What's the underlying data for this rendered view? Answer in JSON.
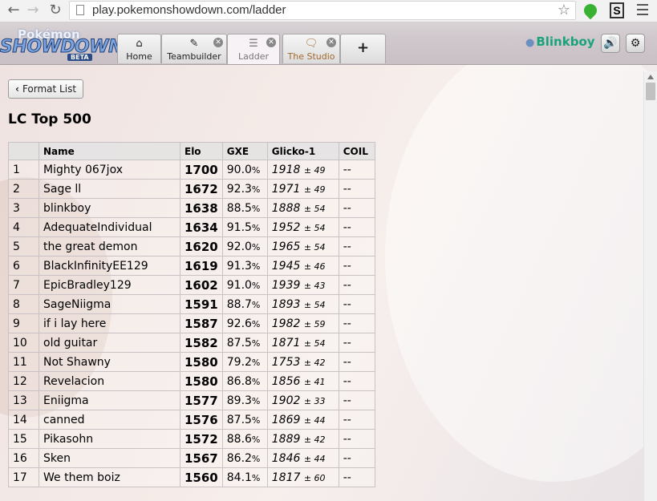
{
  "browser": {
    "url": "play.pokemonshowdown.com/ladder",
    "icons": {
      "back": "arrow-left-icon",
      "forward": "arrow-right-icon",
      "reload": "reload-icon",
      "star": "star-icon",
      "menu": "menu-icon"
    },
    "ext_s_label": "S"
  },
  "header": {
    "logo": {
      "top": "Pokémon",
      "main": "SHOWDOWN!",
      "badge": "BETA"
    },
    "tabs": [
      {
        "label": "Home",
        "icon": "home-icon",
        "closable": false
      },
      {
        "label": "Teambuilder",
        "icon": "edit-icon",
        "closable": true
      },
      {
        "label": "Ladder",
        "icon": "list-icon",
        "closable": true,
        "active": true
      },
      {
        "label": "The Studio",
        "icon": "chat-icon",
        "closable": true
      }
    ],
    "new_tab_label": "+",
    "username": "Blinkboy",
    "accent_user": "#1aa37a"
  },
  "content": {
    "back_button": "Format List",
    "title": "LC Top 500",
    "columns": [
      "",
      "Name",
      "Elo",
      "GXE",
      "Glicko-1",
      "COIL"
    ],
    "rows": [
      {
        "rank": "1",
        "name": "Mighty 067jox",
        "elo": "1700",
        "gxe": "90.0",
        "glicko": "1918",
        "dev": "± 49",
        "coil": "--"
      },
      {
        "rank": "2",
        "name": "Sage ll",
        "elo": "1672",
        "gxe": "92.3",
        "glicko": "1971",
        "dev": "± 49",
        "coil": "--"
      },
      {
        "rank": "3",
        "name": "blinkboy",
        "elo": "1638",
        "gxe": "88.5",
        "glicko": "1888",
        "dev": "± 54",
        "coil": "--"
      },
      {
        "rank": "4",
        "name": "AdequateIndividual",
        "elo": "1634",
        "gxe": "91.5",
        "glicko": "1952",
        "dev": "± 54",
        "coil": "--"
      },
      {
        "rank": "5",
        "name": "the great demon",
        "elo": "1620",
        "gxe": "92.0",
        "glicko": "1965",
        "dev": "± 54",
        "coil": "--"
      },
      {
        "rank": "6",
        "name": "BlackInfinityEE129",
        "elo": "1619",
        "gxe": "91.3",
        "glicko": "1945",
        "dev": "± 46",
        "coil": "--"
      },
      {
        "rank": "7",
        "name": "EpicBradley129",
        "elo": "1602",
        "gxe": "91.0",
        "glicko": "1939",
        "dev": "± 43",
        "coil": "--"
      },
      {
        "rank": "8",
        "name": "SageNiigma",
        "elo": "1591",
        "gxe": "88.7",
        "glicko": "1893",
        "dev": "± 54",
        "coil": "--"
      },
      {
        "rank": "9",
        "name": "if i lay here",
        "elo": "1587",
        "gxe": "92.6",
        "glicko": "1982",
        "dev": "± 59",
        "coil": "--"
      },
      {
        "rank": "10",
        "name": "old guitar",
        "elo": "1582",
        "gxe": "87.5",
        "glicko": "1871",
        "dev": "± 54",
        "coil": "--"
      },
      {
        "rank": "11",
        "name": "Not Shawny",
        "elo": "1580",
        "gxe": "79.2",
        "glicko": "1753",
        "dev": "± 42",
        "coil": "--"
      },
      {
        "rank": "12",
        "name": "Revelacion",
        "elo": "1580",
        "gxe": "86.8",
        "glicko": "1856",
        "dev": "± 41",
        "coil": "--"
      },
      {
        "rank": "13",
        "name": "Eniigma",
        "elo": "1577",
        "gxe": "89.3",
        "glicko": "1902",
        "dev": "± 33",
        "coil": "--"
      },
      {
        "rank": "14",
        "name": "canned",
        "elo": "1576",
        "gxe": "87.5",
        "glicko": "1869",
        "dev": "± 44",
        "coil": "--"
      },
      {
        "rank": "15",
        "name": "Pikasohn",
        "elo": "1572",
        "gxe": "88.6",
        "glicko": "1889",
        "dev": "± 42",
        "coil": "--"
      },
      {
        "rank": "16",
        "name": "Sken",
        "elo": "1567",
        "gxe": "86.2",
        "glicko": "1846",
        "dev": "± 44",
        "coil": "--"
      },
      {
        "rank": "17",
        "name": "We them boiz",
        "elo": "1560",
        "gxe": "84.1",
        "glicko": "1817",
        "dev": "± 60",
        "coil": "--"
      }
    ]
  }
}
